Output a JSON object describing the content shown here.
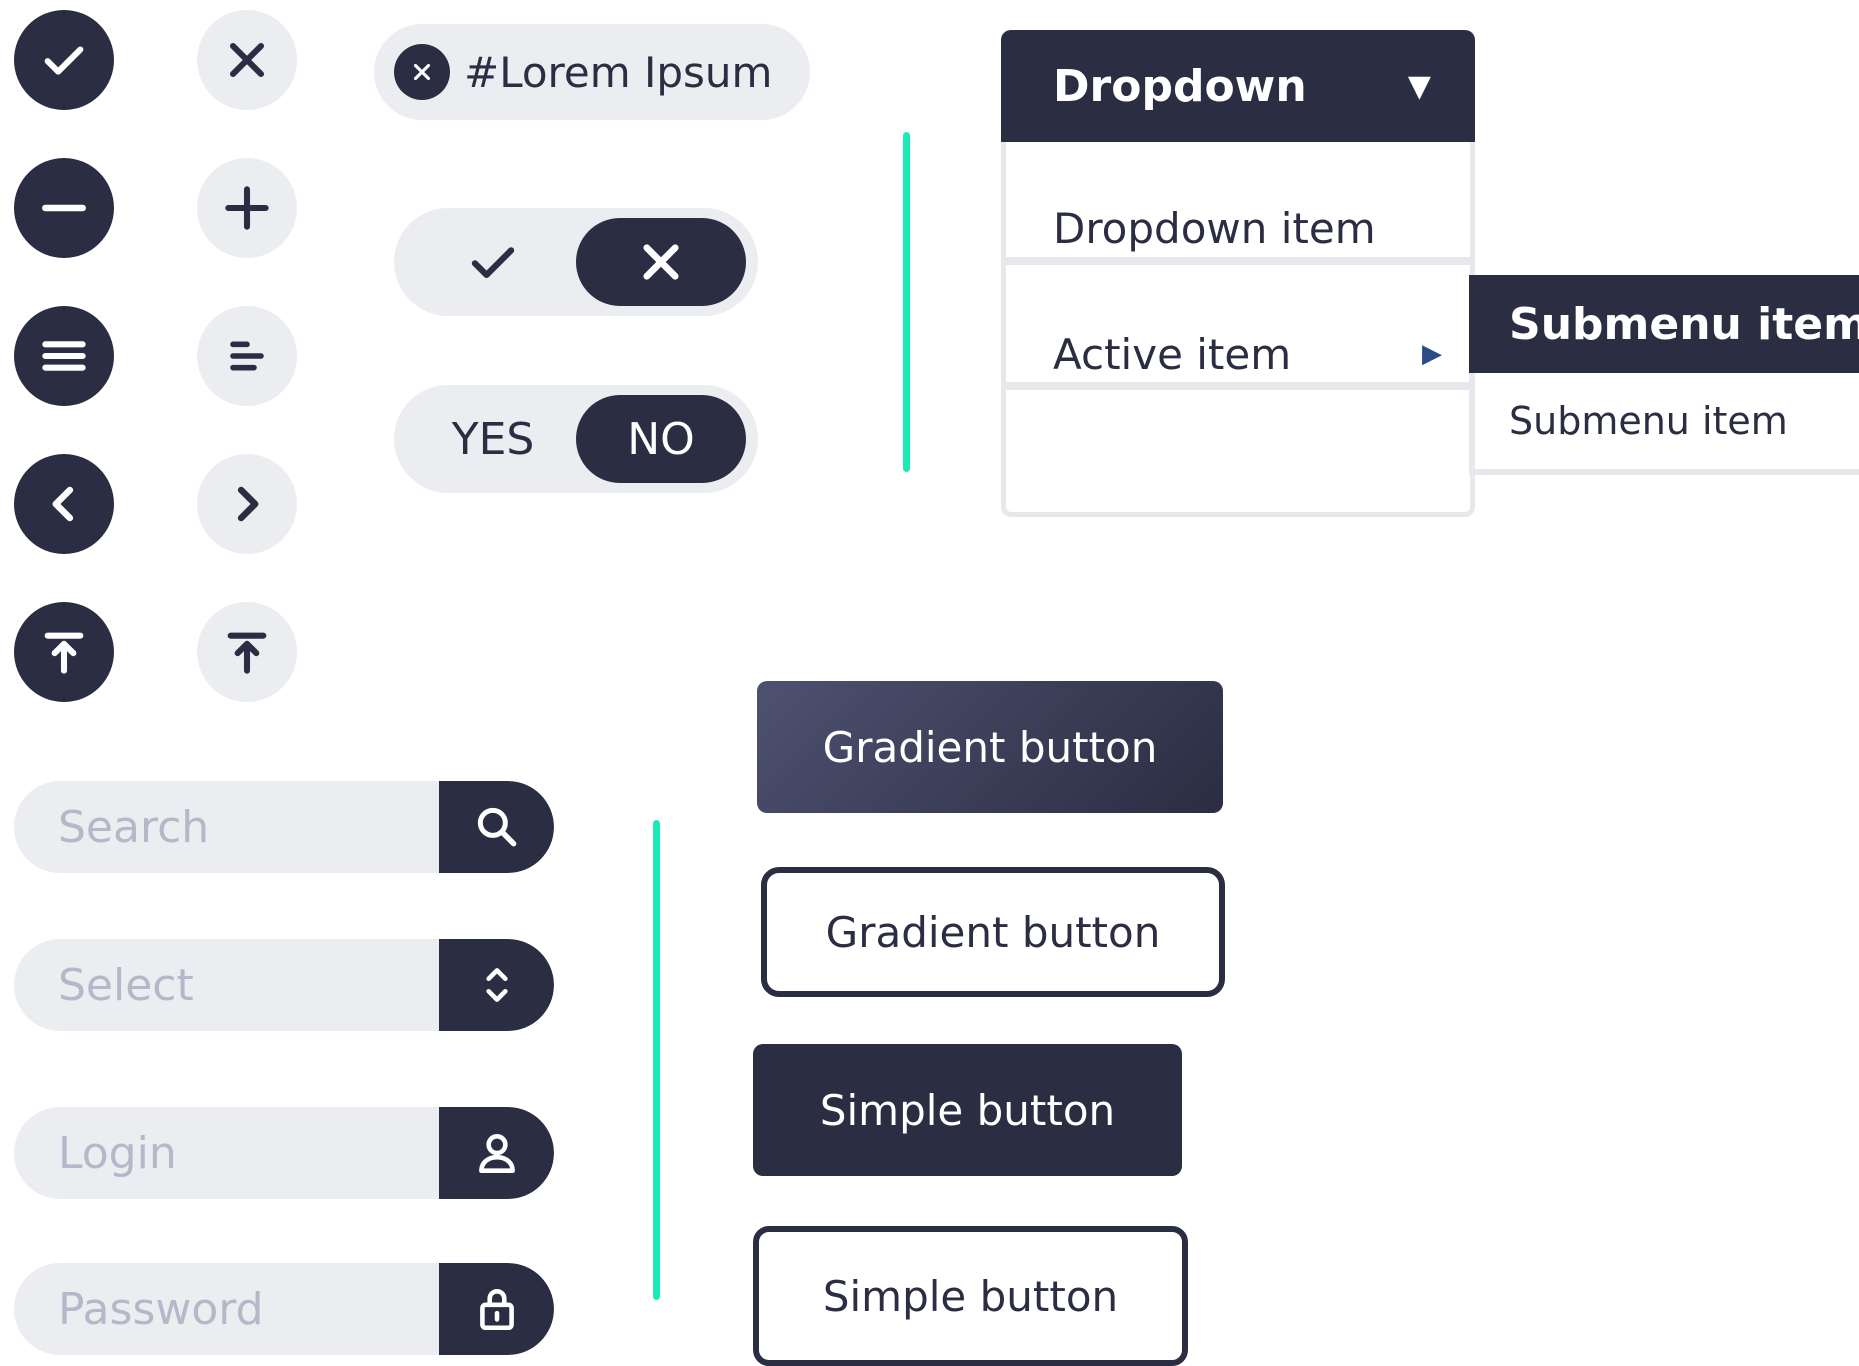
{
  "icon_buttons": [
    {
      "name": "check",
      "style": "dark"
    },
    {
      "name": "close",
      "style": "light"
    },
    {
      "name": "minus",
      "style": "dark"
    },
    {
      "name": "plus",
      "style": "light"
    },
    {
      "name": "menu",
      "style": "dark"
    },
    {
      "name": "align-center",
      "style": "light"
    },
    {
      "name": "chevron-left",
      "style": "dark"
    },
    {
      "name": "chevron-right",
      "style": "light"
    },
    {
      "name": "upload",
      "style": "dark"
    },
    {
      "name": "upload",
      "style": "light"
    }
  ],
  "tag": {
    "label": "#Lorem Ipsum",
    "remove_icon": "close-icon"
  },
  "toggles": [
    {
      "left_icon": "check-icon",
      "right_icon": "close-icon",
      "selected": "right"
    },
    {
      "left_label": "YES",
      "right_label": "NO",
      "selected": "right"
    }
  ],
  "dropdown": {
    "title": "Dropdown",
    "caret": "▼",
    "items": [
      {
        "label": "Dropdown item"
      },
      {
        "label": "Active item",
        "has_submenu": true,
        "arrow": "▶"
      },
      {
        "label": ""
      }
    ],
    "submenu": {
      "active_label": "Submenu item",
      "item_label": "Submenu item"
    }
  },
  "fields": {
    "search": {
      "placeholder": "Search",
      "icon": "search-icon"
    },
    "select": {
      "placeholder": "Select",
      "icon": "up-down-chevron-icon"
    },
    "login": {
      "placeholder": "Login",
      "icon": "user-icon"
    },
    "password": {
      "placeholder": "Password",
      "icon": "lock-icon"
    }
  },
  "buttons": {
    "gradient": "Gradient button",
    "gradient_outline": "Gradient button",
    "simple": "Simple button",
    "simple_outline": "Simple button"
  },
  "colors": {
    "dark": "#2b2d42",
    "light": "#ecedf1",
    "accent": "#1de9b6",
    "placeholder": "#b5b8c8"
  }
}
